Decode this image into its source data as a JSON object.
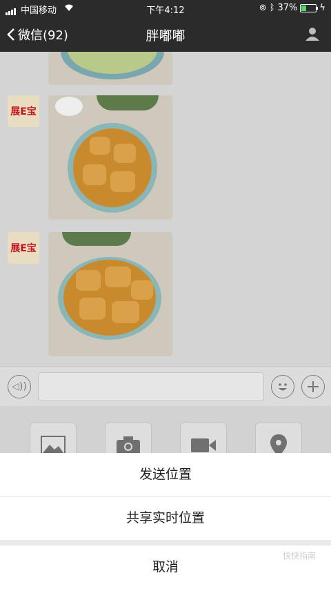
{
  "status_bar": {
    "carrier": "中国移动",
    "time": "下午4:12",
    "battery_percent": "37%",
    "battery_level": 0.37
  },
  "nav": {
    "back_label": "微信(92)",
    "title": "胖嘟嘟"
  },
  "chat": {
    "avatar_text": "展E宝",
    "messages": [
      {
        "type": "image",
        "content": "food-photo"
      },
      {
        "type": "image",
        "content": "food-photo"
      },
      {
        "type": "image",
        "content": "food-photo"
      }
    ]
  },
  "input_bar": {
    "voice_icon": "voice-icon",
    "emoji_icon": "emoji-icon",
    "plus_icon": "plus-icon"
  },
  "tools": [
    "photo-icon",
    "camera-icon",
    "video-icon",
    "location-icon"
  ],
  "action_sheet": {
    "send_location": "发送位置",
    "share_live_location": "共享实时位置",
    "cancel": "取消"
  },
  "watermark": "快快指南"
}
